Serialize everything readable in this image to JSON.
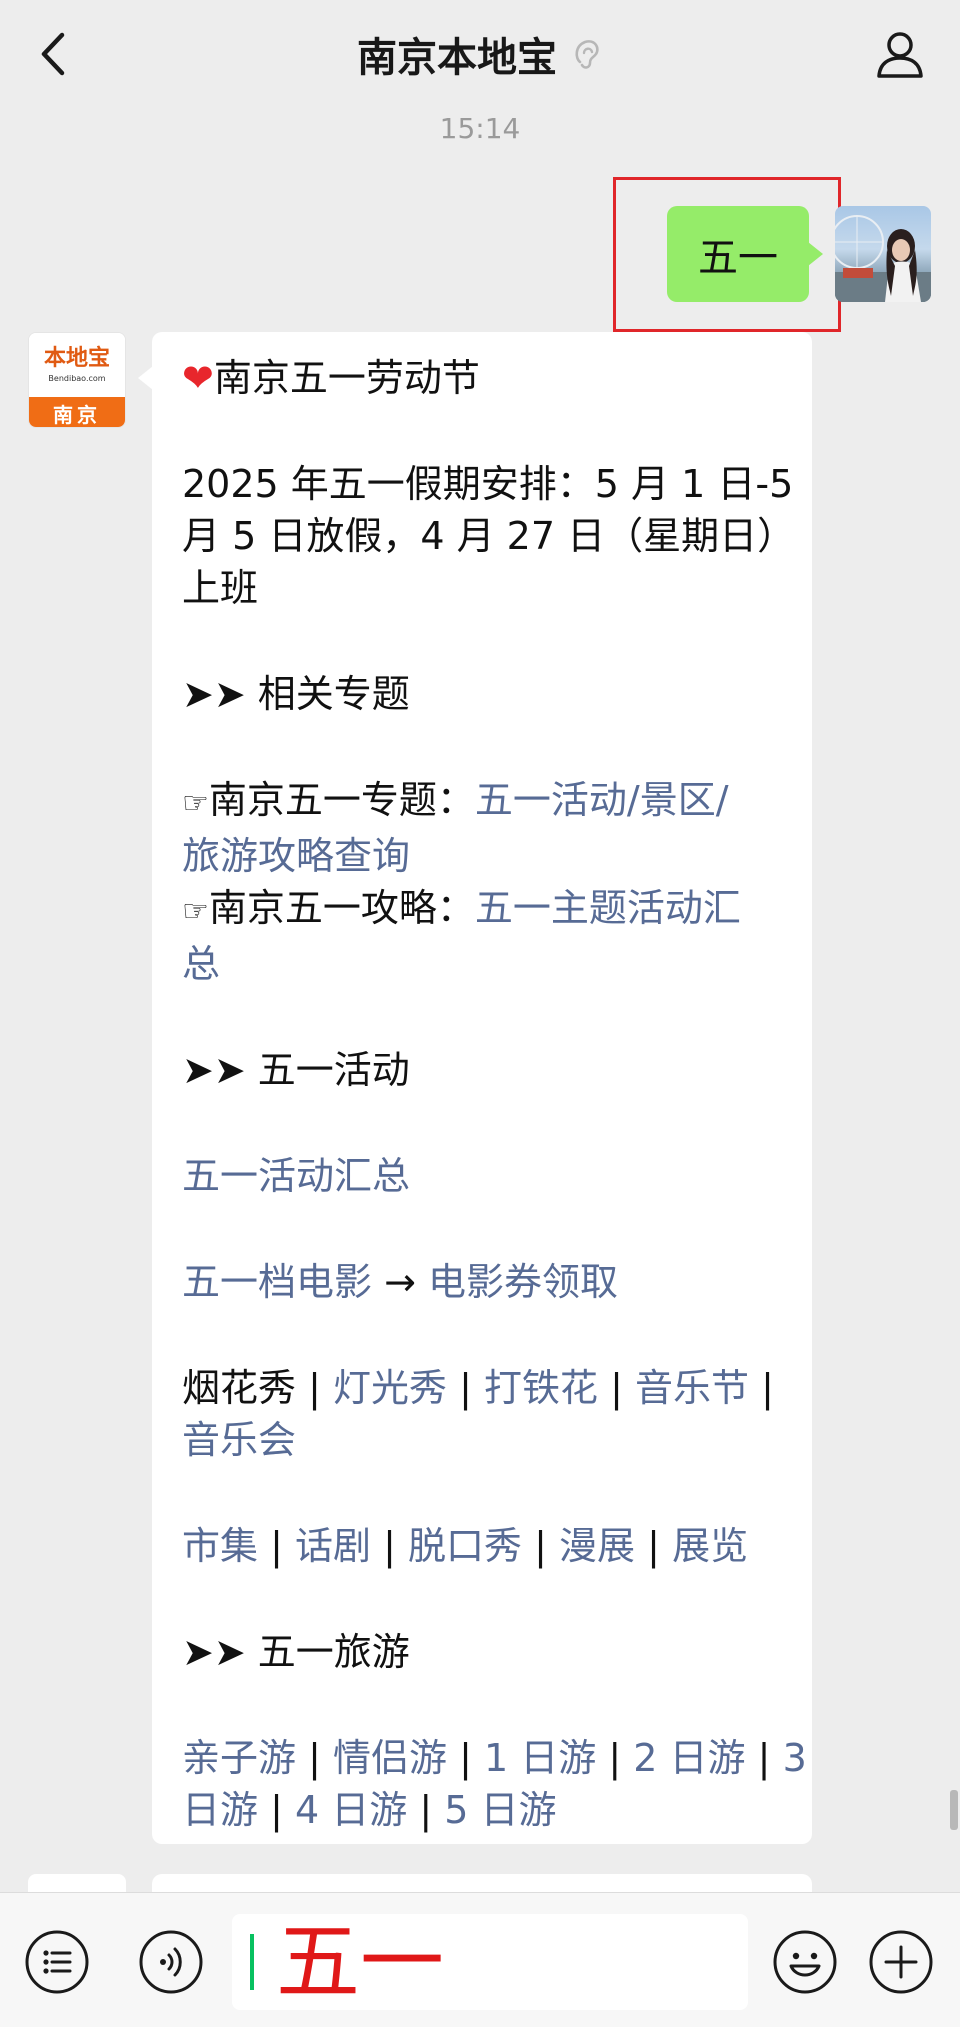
{
  "header": {
    "title": "南京本地宝"
  },
  "chat": {
    "timestamp": "15:14",
    "user_message": "五一",
    "bot_avatar": {
      "logo_text": "本地宝",
      "logo_sub": "Bendibao.com",
      "city": "南京"
    }
  },
  "article": {
    "title_line": "南京五一劳动节",
    "holiday_l1": "2025 年五一假期安排：5 月 1 日-5",
    "holiday_l2": "月 5 日放假，4 月 27 日（星期日）",
    "holiday_l3": "上班",
    "section1": "➤➤ 相关专题",
    "topic1_prefix": "南京五一专题：",
    "topic1_link_a": "五一活动/景区/",
    "topic1_link_b": "旅游攻略查询",
    "topic2_prefix": "南京五一攻略：",
    "topic2_link_a": "五一主题活动汇",
    "topic2_link_b": "总",
    "section2": "➤➤ 五一活动",
    "activities_summary": "五一活动汇总",
    "movie_link": "五一档电影",
    "arrow": "→",
    "movie_coupon": "电影券领取",
    "show_plain": "烟花秀",
    "show_links": [
      "灯光秀",
      "打铁花",
      "音乐节"
    ],
    "show_link_wrap": "音乐会",
    "misc_links": [
      "市集",
      "话剧",
      "脱口秀",
      "漫展",
      "展览"
    ],
    "section3": "➤➤ 五一旅游",
    "tour_l1": [
      "亲子游",
      "情侣游",
      "1 日游",
      "2 日游"
    ],
    "tour_l1_tail": "3",
    "tour_l2_head": "日游",
    "tour_l2": [
      "4 日游",
      "5 日游"
    ],
    "separator": "|"
  },
  "input": {
    "text": "五一"
  },
  "colors": {
    "user_bubble": "#95ec69",
    "link": "#576b95",
    "highlight": "#e0262a",
    "caret": "#07c160",
    "input_text": "#e01818"
  }
}
